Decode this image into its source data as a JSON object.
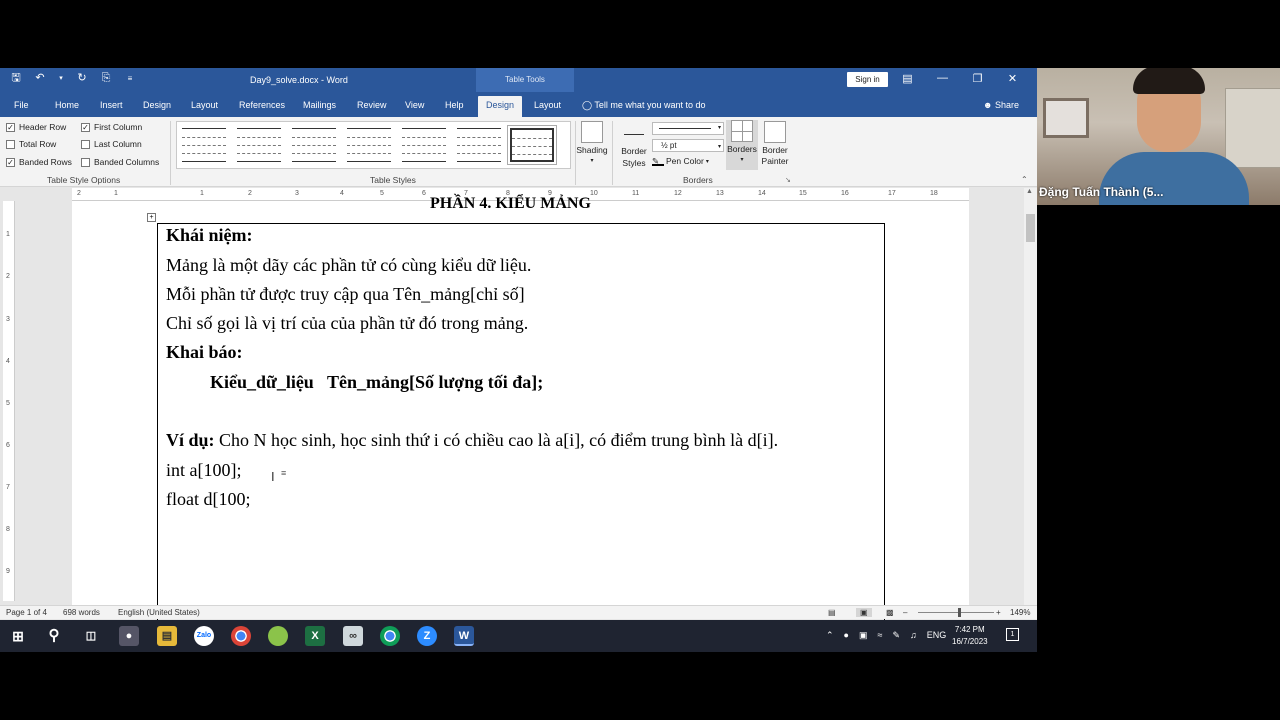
{
  "titlebar": {
    "qat": [
      "save-icon",
      "undo-icon",
      "dropdown-icon",
      "redo-icon",
      "print-preview-icon",
      "customize-icon"
    ],
    "doc_title": "Day9_solve.docx  -  Word",
    "context_tab": "Table Tools",
    "signin": "Sign in",
    "window_buttons": [
      "ribbon-display-icon",
      "minimize-icon",
      "restore-icon",
      "close-icon"
    ]
  },
  "menu": {
    "tabs": [
      "File",
      "Home",
      "Insert",
      "Design",
      "Layout",
      "References",
      "Mailings",
      "Review",
      "View",
      "Help",
      "Design",
      "Layout"
    ],
    "active_index": 10,
    "tellme": "Tell me what you want to do",
    "share": "Share"
  },
  "ribbon": {
    "style_options": {
      "items": [
        {
          "label": "Header Row",
          "checked": true
        },
        {
          "label": "First Column",
          "checked": true
        },
        {
          "label": "Total Row",
          "checked": false
        },
        {
          "label": "Last Column",
          "checked": false
        },
        {
          "label": "Banded Rows",
          "checked": true
        },
        {
          "label": "Banded Columns",
          "checked": false
        }
      ],
      "group": "Table Style Options"
    },
    "table_styles": {
      "group": "Table Styles",
      "count": 7,
      "selected": 6
    },
    "shading": "Shading",
    "borders": {
      "border_styles": "Border Styles",
      "line_style": "",
      "line_weight": "½ pt",
      "pen_color": "Pen Color",
      "borders": "Borders",
      "border_painter": "Border Painter",
      "group": "Borders"
    }
  },
  "ruler": {
    "h_marks": [
      "2",
      "1",
      "1",
      "2",
      "3",
      "4",
      "5",
      "6",
      "7",
      "8",
      "9",
      "10",
      "11",
      "12",
      "13",
      "14",
      "15",
      "16",
      "17",
      "18"
    ],
    "v_marks": [
      "1",
      "2",
      "3",
      "4",
      "5",
      "6",
      "7",
      "8",
      "9",
      "10"
    ]
  },
  "document": {
    "heading": "PHẦN 4. KIỂU MẢNG",
    "lines": [
      {
        "bold": "Khái niệm:",
        "text": ""
      },
      {
        "bold": "",
        "text": "Mảng là một dãy các phần tử có cùng kiểu dữ liệu."
      },
      {
        "bold": "",
        "text": "Mỗi phần tử được truy cập qua Tên_mảng[chỉ số]"
      },
      {
        "bold": "",
        "text": "Chỉ số gọi là vị trí của của phần tử đó trong mảng."
      },
      {
        "bold": "Khai báo:",
        "text": ""
      },
      {
        "bold": "Kiểu_dữ_liệu   Tên_mảng[Số lượng tối đa];",
        "text": ""
      },
      {
        "bold": "",
        "text": ""
      },
      {
        "bold": "Ví dụ:",
        "text": " Cho N học sinh, học sinh thứ i có chiều cao là a[i], có điểm trung bình là d[i]."
      },
      {
        "bold": "",
        "text": "int a[100];"
      },
      {
        "bold": "",
        "text": "float d[100;"
      }
    ]
  },
  "status": {
    "page": "Page 1 of 4",
    "words": "698 words",
    "language": "English (United States)",
    "zoom": "149%"
  },
  "taskbar": {
    "apps": [
      "start-icon",
      "search-icon",
      "task-view-icon",
      "camera-icon",
      "file-explorer-icon",
      "zalo-icon",
      "chrome-icon",
      "app-icon",
      "excel-icon",
      "app-icon-2",
      "chrome-icon-2",
      "zoom-icon",
      "word-icon"
    ],
    "lang": "ENG",
    "time": "7:42 PM",
    "date": "16/7/2023",
    "notif": "1"
  },
  "webcam": {
    "name": "Đặng Tuấn Thành (5..."
  }
}
